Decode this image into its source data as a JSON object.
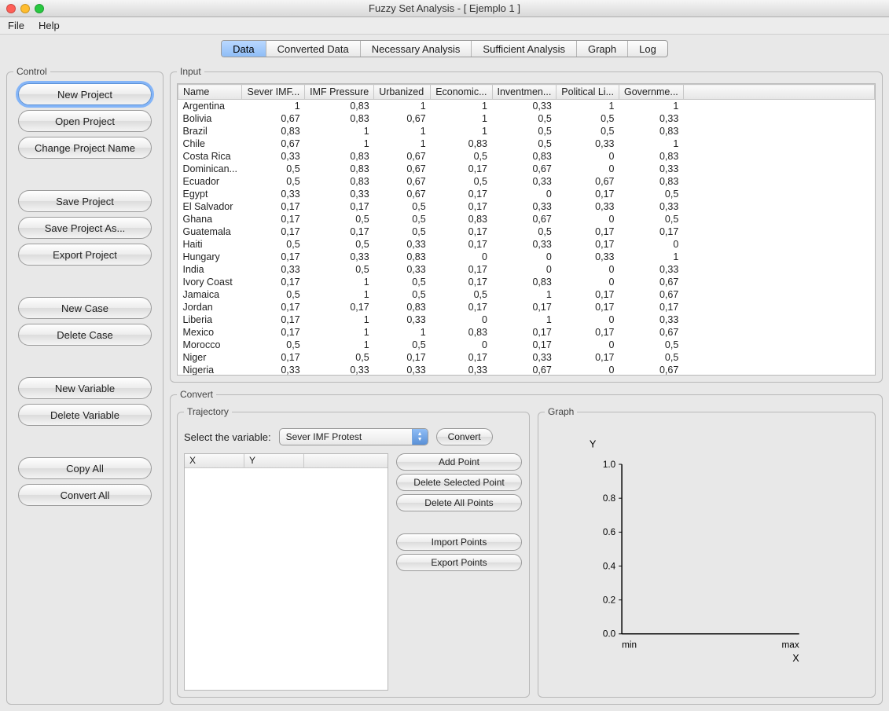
{
  "window": {
    "title": "Fuzzy Set Analysis - [ Ejemplo 1 ]"
  },
  "menu": {
    "file": "File",
    "help": "Help"
  },
  "tabs": {
    "data": "Data",
    "converted": "Converted Data",
    "necessary": "Necessary Analysis",
    "sufficient": "Sufficient Analysis",
    "graph": "Graph",
    "log": "Log"
  },
  "control": {
    "legend": "Control",
    "new_project": "New Project",
    "open_project": "Open Project",
    "change_name": "Change Project Name",
    "save_project": "Save Project",
    "save_as": "Save Project As...",
    "export_project": "Export Project",
    "new_case": "New Case",
    "delete_case": "Delete Case",
    "new_variable": "New Variable",
    "delete_variable": "Delete Variable",
    "copy_all": "Copy All",
    "convert_all": "Convert All"
  },
  "input": {
    "legend": "Input",
    "headers": [
      "Name",
      "Sever IMF...",
      "IMF Pressure",
      "Urbanized",
      "Economic...",
      "Inventmen...",
      "Political Li...",
      "Governme..."
    ],
    "rows": [
      [
        "Argentina",
        "1",
        "0,83",
        "1",
        "1",
        "0,33",
        "1",
        "1"
      ],
      [
        "Bolivia",
        "0,67",
        "0,83",
        "0,67",
        "1",
        "0,5",
        "0,5",
        "0,33"
      ],
      [
        "Brazil",
        "0,83",
        "1",
        "1",
        "1",
        "0,5",
        "0,5",
        "0,83"
      ],
      [
        "Chile",
        "0,67",
        "1",
        "1",
        "0,83",
        "0,5",
        "0,33",
        "1"
      ],
      [
        "Costa Rica",
        "0,33",
        "0,83",
        "0,67",
        "0,5",
        "0,83",
        "0",
        "0,83"
      ],
      [
        "Dominican...",
        "0,5",
        "0,83",
        "0,67",
        "0,17",
        "0,67",
        "0",
        "0,33"
      ],
      [
        "Ecuador",
        "0,5",
        "0,83",
        "0,67",
        "0,5",
        "0,33",
        "0,67",
        "0,83"
      ],
      [
        "Egypt",
        "0,33",
        "0,33",
        "0,67",
        "0,17",
        "0",
        "0,17",
        "0,5"
      ],
      [
        "El Salvador",
        "0,17",
        "0,17",
        "0,5",
        "0,17",
        "0,33",
        "0,33",
        "0,33"
      ],
      [
        "Ghana",
        "0,17",
        "0,5",
        "0,5",
        "0,83",
        "0,67",
        "0",
        "0,5"
      ],
      [
        "Guatemala",
        "0,17",
        "0,17",
        "0,5",
        "0,17",
        "0,5",
        "0,17",
        "0,17"
      ],
      [
        "Haiti",
        "0,5",
        "0,5",
        "0,33",
        "0,17",
        "0,33",
        "0,17",
        "0"
      ],
      [
        "Hungary",
        "0,17",
        "0,33",
        "0,83",
        "0",
        "0",
        "0,33",
        "1"
      ],
      [
        "India",
        "0,33",
        "0,5",
        "0,33",
        "0,17",
        "0",
        "0",
        "0,33"
      ],
      [
        "Ivory Coast",
        "0,17",
        "1",
        "0,5",
        "0,17",
        "0,83",
        "0",
        "0,67"
      ],
      [
        "Jamaica",
        "0,5",
        "1",
        "0,5",
        "0,5",
        "1",
        "0,17",
        "0,67"
      ],
      [
        "Jordan",
        "0,17",
        "0,17",
        "0,83",
        "0,17",
        "0,17",
        "0,17",
        "0,17"
      ],
      [
        "Liberia",
        "0,17",
        "1",
        "0,33",
        "0",
        "1",
        "0",
        "0,33"
      ],
      [
        "Mexico",
        "0,17",
        "1",
        "1",
        "0,83",
        "0,17",
        "0,17",
        "0,67"
      ],
      [
        "Morocco",
        "0,5",
        "1",
        "0,5",
        "0",
        "0,17",
        "0",
        "0,5"
      ],
      [
        "Niger",
        "0,17",
        "0,5",
        "0,17",
        "0,17",
        "0,33",
        "0,17",
        "0,5"
      ],
      [
        "Nigeria",
        "0,33",
        "0,33",
        "0,33",
        "0,33",
        "0,67",
        "0",
        "0,67"
      ]
    ]
  },
  "convert": {
    "legend": "Convert",
    "trajectory": {
      "legend": "Trajectory",
      "select_label": "Select the variable:",
      "selected": "Sever IMF Protest",
      "convert_btn": "Convert",
      "col_x": "X",
      "col_y": "Y",
      "add_point": "Add Point",
      "delete_selected": "Delete Selected Point",
      "delete_all": "Delete All Points",
      "import_points": "Import Points",
      "export_points": "Export Points"
    },
    "graph": {
      "legend": "Graph",
      "ylabel": "Y",
      "xlabel": "X",
      "xmin": "min",
      "xmax": "max",
      "yticks": [
        "0.0",
        "0.2",
        "0.4",
        "0.6",
        "0.8",
        "1.0"
      ]
    }
  },
  "chart_data": {
    "type": "line",
    "title": "",
    "xlabel": "X",
    "ylabel": "Y",
    "ylim": [
      0.0,
      1.0
    ],
    "xticks": [
      "min",
      "max"
    ],
    "yticks": [
      0.0,
      0.2,
      0.4,
      0.6,
      0.8,
      1.0
    ],
    "series": []
  }
}
